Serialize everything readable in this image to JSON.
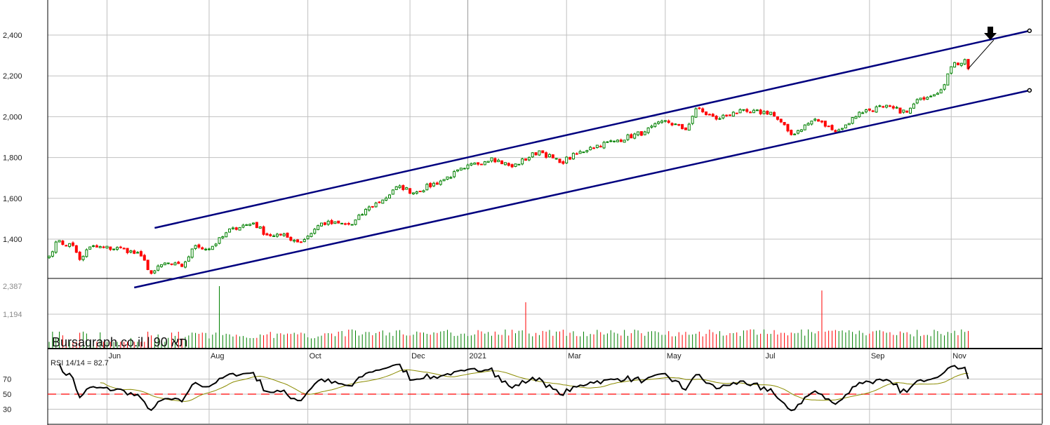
{
  "chart_data": {
    "type": "candlestick",
    "watermark": "Bursagraph.co.il | 90 תא",
    "price_axis": {
      "ticks": [
        1400,
        1600,
        1800,
        2000,
        2200,
        2400
      ],
      "labels": [
        "1,400",
        "1,600",
        "1,800",
        "2,000",
        "2,200",
        "2,400"
      ],
      "range": [
        1210,
        2570
      ]
    },
    "volume_axis": {
      "labels": [
        "2,387",
        "1,194"
      ],
      "ticks": [
        2387,
        1194
      ]
    },
    "rsi": {
      "label": "RSI 14/14 = 82.7",
      "ticks": [
        30,
        50,
        70
      ],
      "labels": [
        "30",
        "50",
        "70"
      ],
      "reference_level": 50,
      "period": 14,
      "ma_period": 14
    },
    "x_labels": [
      {
        "day": 17,
        "label": "Jun"
      },
      {
        "day": 47,
        "label": "Aug"
      },
      {
        "day": 76,
        "label": "Oct"
      },
      {
        "day": 106,
        "label": "Dec"
      },
      {
        "day": 123,
        "label": "2021",
        "major": true
      },
      {
        "day": 152,
        "label": "Mar"
      },
      {
        "day": 181,
        "label": "May"
      },
      {
        "day": 210,
        "label": "Jul"
      },
      {
        "day": 241,
        "label": "Sep"
      },
      {
        "day": 265,
        "label": "Nov"
      }
    ],
    "close_keypoints": [
      [
        0,
        1317
      ],
      [
        2,
        1386
      ],
      [
        7,
        1369
      ],
      [
        9,
        1300
      ],
      [
        12,
        1362
      ],
      [
        22,
        1352
      ],
      [
        27,
        1317
      ],
      [
        30,
        1232
      ],
      [
        34,
        1283
      ],
      [
        39,
        1266
      ],
      [
        43,
        1369
      ],
      [
        47,
        1352
      ],
      [
        54,
        1455
      ],
      [
        60,
        1479
      ],
      [
        64,
        1420
      ],
      [
        68,
        1420
      ],
      [
        74,
        1386
      ],
      [
        80,
        1479
      ],
      [
        89,
        1472
      ],
      [
        94,
        1558
      ],
      [
        98,
        1592
      ],
      [
        103,
        1661
      ],
      [
        107,
        1627
      ],
      [
        115,
        1685
      ],
      [
        122,
        1747
      ],
      [
        130,
        1799
      ],
      [
        136,
        1754
      ],
      [
        144,
        1833
      ],
      [
        150,
        1775
      ],
      [
        159,
        1850
      ],
      [
        167,
        1885
      ],
      [
        175,
        1926
      ],
      [
        181,
        1981
      ],
      [
        187,
        1936
      ],
      [
        190,
        2039
      ],
      [
        196,
        1988
      ],
      [
        201,
        2022
      ],
      [
        206,
        2022
      ],
      [
        212,
        2022
      ],
      [
        218,
        1912
      ],
      [
        225,
        1988
      ],
      [
        230,
        1936
      ],
      [
        233,
        1943
      ],
      [
        238,
        2022
      ],
      [
        245,
        2049
      ],
      [
        252,
        2022
      ],
      [
        256,
        2091
      ],
      [
        262,
        2132
      ],
      [
        265,
        2245
      ],
      [
        269,
        2280
      ],
      [
        270,
        2235
      ]
    ],
    "volume_spikes": [
      [
        50,
        2387
      ],
      [
        140,
        1700
      ],
      [
        227,
        2200
      ]
    ],
    "trendlines": [
      {
        "name": "upper-channel",
        "from": [
          31,
          1455
        ],
        "to": [
          288,
          2421
        ],
        "color": "#00007f"
      },
      {
        "name": "lower-channel",
        "from": [
          25,
          1163
        ],
        "to": [
          288,
          2129
        ],
        "color": "#00007f"
      },
      {
        "name": "projection",
        "from": [
          270,
          2235
        ],
        "to": [
          277.5,
          2376
        ],
        "color": "#000000"
      }
    ],
    "arrow_marker": {
      "day": 276.5,
      "price": 2400,
      "direction": "down"
    },
    "colors": {
      "up": "#008000",
      "down": "#ff0000",
      "rsi": "#000000",
      "rsi_ma": "#8b8b00",
      "ref": "#ff0000",
      "grid": "#c0c0c0"
    }
  }
}
